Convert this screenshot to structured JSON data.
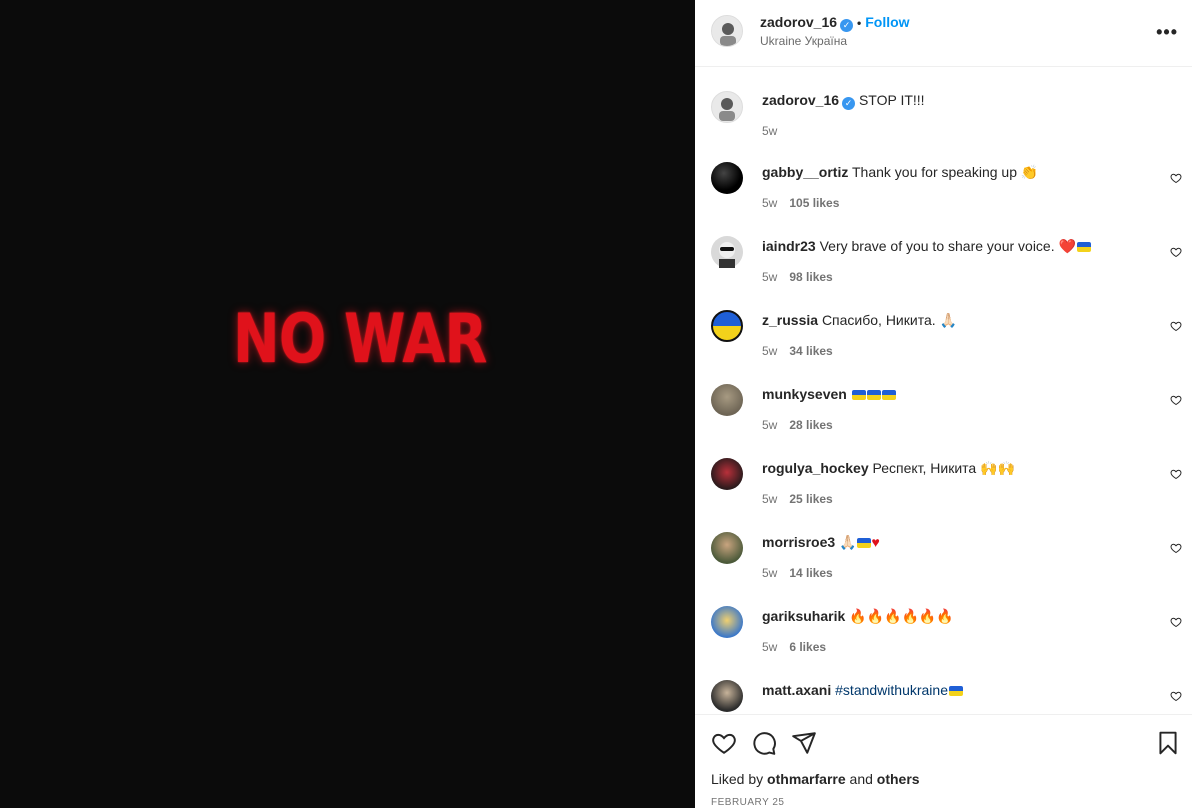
{
  "media": {
    "text": "NO WAR"
  },
  "header": {
    "username": "zadorov_16",
    "separator": "•",
    "follow_label": "Follow",
    "location": "Ukraine Україна",
    "more_label": "•••"
  },
  "caption": {
    "username": "zadorov_16",
    "text": "STOP IT!!!",
    "age": "5w"
  },
  "comments": [
    {
      "username": "gabby__ortiz",
      "text": "Thank you for speaking up 👏",
      "age": "5w",
      "likes": "105 likes"
    },
    {
      "username": "iaindr23",
      "text": "Very brave of you to share your voice. ❤️",
      "age": "5w",
      "likes": "98 likes"
    },
    {
      "username": "z_russia",
      "text": "Спасибо, Никита. 🙏🏻",
      "age": "5w",
      "likes": "34 likes"
    },
    {
      "username": "munkyseven",
      "text": "",
      "age": "5w",
      "likes": "28 likes"
    },
    {
      "username": "rogulya_hockey",
      "text": "Респект, Никита 🙌🙌",
      "age": "5w",
      "likes": "25 likes"
    },
    {
      "username": "morrisroe3",
      "text": "🙏🏻",
      "age": "5w",
      "likes": "14 likes"
    },
    {
      "username": "gariksuharik",
      "text": "🔥🔥🔥🔥🔥🔥",
      "age": "5w",
      "likes": "6 likes"
    },
    {
      "username": "matt.axani",
      "text": "#standwithukraine",
      "age": "",
      "likes": ""
    }
  ],
  "footer": {
    "liked_prefix": "Liked by",
    "liked_user": "othmarfarre",
    "liked_and": "and",
    "liked_others": "others",
    "date": "FEBRUARY 25"
  },
  "colors": {
    "accent": "#0095f6",
    "media_bg": "#0b0b0b",
    "media_text": "#e0121b",
    "verified": "#3897f0"
  }
}
